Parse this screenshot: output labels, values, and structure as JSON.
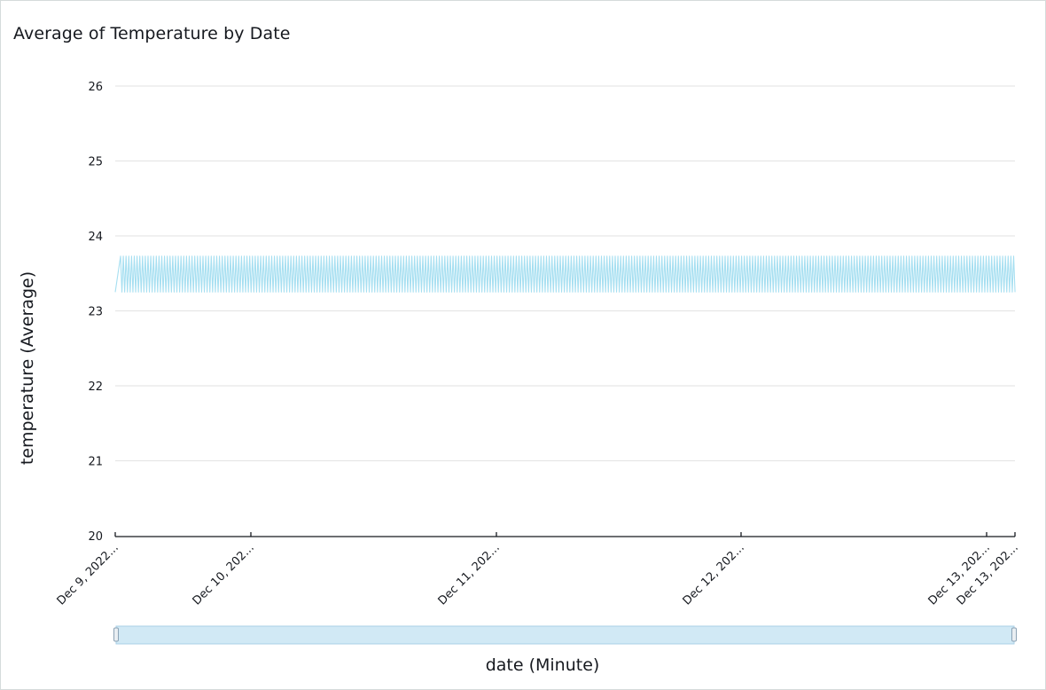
{
  "chart_data": {
    "type": "line",
    "title": "Average of Temperature by Date",
    "xlabel": "date (Minute)",
    "ylabel": "temperature (Average)",
    "ylim": [
      20,
      26
    ],
    "yticks": [
      20,
      21,
      22,
      23,
      24,
      25,
      26
    ],
    "xtick_labels": [
      "Dec 9, 2022...",
      "Dec 10, 202...",
      "Dec 11, 202...",
      "Dec 12, 202...",
      "Dec 13, 202...",
      "Dec 13, 202..."
    ],
    "grid": true,
    "legend": "none",
    "series": [
      {
        "color": "#a6dff1",
        "oscillation_low": 23.25,
        "oscillation_high": 23.73,
        "start_value": 23.25
      }
    ]
  },
  "range_slider": {
    "fill_color": "#d1e9f5",
    "border_color": "#a9cfe6"
  }
}
